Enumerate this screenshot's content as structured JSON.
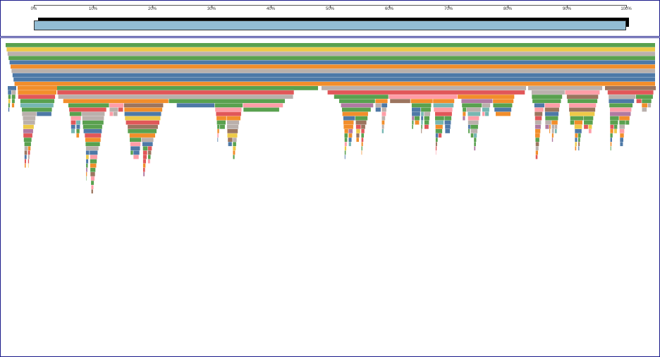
{
  "navigator": {
    "ticks": [
      "0%",
      "10%",
      "20%",
      "30%",
      "40%",
      "50%",
      "60%",
      "70%",
      "80%",
      "90%",
      "100%"
    ],
    "brush_start": 0.0,
    "brush_end": 1.0
  },
  "flame": {
    "palette": [
      "#4e79a7",
      "#f28e2b",
      "#e15759",
      "#76b7b2",
      "#59a14f",
      "#edc948",
      "#b07aa1",
      "#ff9da7",
      "#9c755f",
      "#bab0ac"
    ]
  }
}
